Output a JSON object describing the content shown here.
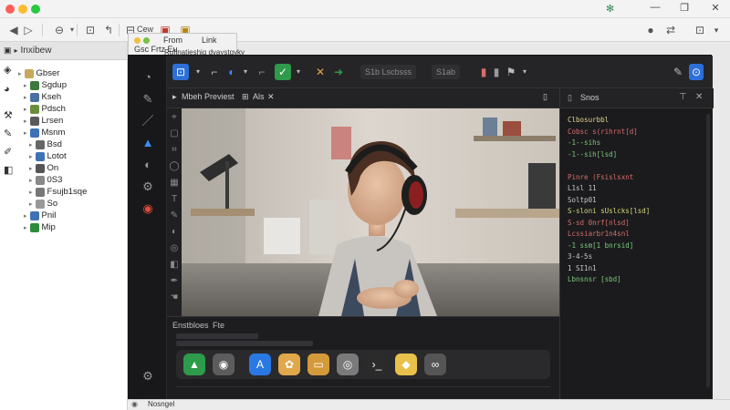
{
  "window": {
    "title_icon": "leaf-icon",
    "controls": [
      "minimize-icon",
      "maximize-icon",
      "close-icon"
    ]
  },
  "toolbar": {
    "nav_back": "back-icon",
    "nav_forward": "forward-icon",
    "items": [
      {
        "name": "history-icon"
      },
      {
        "name": "downloads-icon"
      },
      {
        "name": "share-icon"
      },
      {
        "name": "view-icon",
        "label": "Cew"
      },
      {
        "name": "bookmark-icon"
      },
      {
        "name": "extension-icon"
      }
    ],
    "right_items": [
      "account-icon",
      "split-icon",
      "settings-icon",
      "menu-chevron-icon"
    ]
  },
  "sidebar": {
    "header": "Inxibew",
    "items": [
      {
        "label": "Gbser",
        "indent": 1,
        "color": "#c8a85a"
      },
      {
        "label": "Sgdup",
        "indent": 2,
        "color": "#3c7a3c"
      },
      {
        "label": "Kseh",
        "indent": 2,
        "color": "#4a6fa5"
      },
      {
        "label": "Pdsch",
        "indent": 2,
        "color": "#6a8f3a"
      },
      {
        "label": "Lrsen",
        "indent": 2,
        "color": "#5a5a5a"
      },
      {
        "label": "Msnm",
        "indent": 2,
        "color": "#3f72b5"
      },
      {
        "label": "Bsd",
        "indent": 3,
        "color": "#666666"
      },
      {
        "label": "Lotot",
        "indent": 3,
        "color": "#3f72b5"
      },
      {
        "label": "On",
        "indent": 3,
        "color": "#555555"
      },
      {
        "label": "0S3",
        "indent": 3,
        "color": "#888888"
      },
      {
        "label": "Fsujb1sqe",
        "indent": 3,
        "color": "#777777"
      },
      {
        "label": "So",
        "indent": 3,
        "color": "#999999"
      },
      {
        "label": "Pnil",
        "indent": 2,
        "color": "#3f72b5"
      },
      {
        "label": "Mip",
        "indent": 2,
        "color": "#2e8b3a"
      }
    ],
    "left_icons": [
      "tag-icon",
      "eye-icon",
      "wrench-icon",
      "brush-icon",
      "stamp-icon",
      "sticker-icon"
    ]
  },
  "inner_window": {
    "title_line1": "From",
    "title_line2": "Link",
    "sub_line1": "Gsc Frtz Eu",
    "sub_line2": "Rufinatieshig dvaystgyky"
  },
  "app": {
    "toolbar_pills": [
      "S1b Lscbsss",
      "S1ab"
    ],
    "tabs": [
      "Mbeh Previest",
      "Als"
    ],
    "right_panel_title": "Snos",
    "bottom_tabs": [
      "Enstbloes",
      "Fte"
    ],
    "dock_apps": [
      {
        "name": "app-store-icon",
        "color": "#2e9b4a"
      },
      {
        "name": "preview-icon",
        "color": "#5c5c5c"
      },
      {
        "name": "appstore-blue-icon",
        "color": "#2a78e4"
      },
      {
        "name": "photos-icon",
        "color": "#e0a84a"
      },
      {
        "name": "notes-icon",
        "color": "#d49a3a"
      },
      {
        "name": "camera-icon",
        "color": "#7a7a7a"
      },
      {
        "name": "terminal-icon",
        "color": "#2b2b2b"
      },
      {
        "name": "files-icon",
        "color": "#e8c14a"
      },
      {
        "name": "link-icon",
        "color": "#555555"
      }
    ],
    "code_lines": [
      {
        "text": "  Clbosurbbl",
        "color": "#e6d48a"
      },
      {
        "text": "  Cobsc s(rihrnt[d]",
        "color": "#d66d6d"
      },
      {
        "text": "  -1--sihs",
        "color": "#7ec97e"
      },
      {
        "text": "  -1--sih[lsd]",
        "color": "#7ec97e"
      },
      {
        "text": "",
        "color": "#cccccc"
      },
      {
        "text": "  Pinre (Fsislsxnt",
        "color": "#d66d6d"
      },
      {
        "text": "  L1sl 11",
        "color": "#c8c8c8"
      },
      {
        "text": "  Soltp01",
        "color": "#c8c8c8"
      },
      {
        "text": "  S-sloni sUslcks[lsd]",
        "color": "#d6d67a"
      },
      {
        "text": "  S-sd 0nrf[nlsd]",
        "color": "#d66d6d"
      },
      {
        "text": "  Lcssiarbr1n4snl",
        "color": "#d66d6d"
      },
      {
        "text": "  -1 ssm[1 bnrsid]",
        "color": "#7ec97e"
      },
      {
        "text": "  3-4-5s",
        "color": "#c8c8c8"
      },
      {
        "text": "  1 SI1n1",
        "color": "#c8c8c8"
      },
      {
        "text": "  Lbnsnsr [sbd]",
        "color": "#7ec97e"
      }
    ]
  },
  "status": {
    "label": "Nosngel"
  },
  "colors": {
    "accent": "#3b8cff",
    "app_bg": "#1f1f21",
    "sidebar_bg": "#ffffff"
  }
}
